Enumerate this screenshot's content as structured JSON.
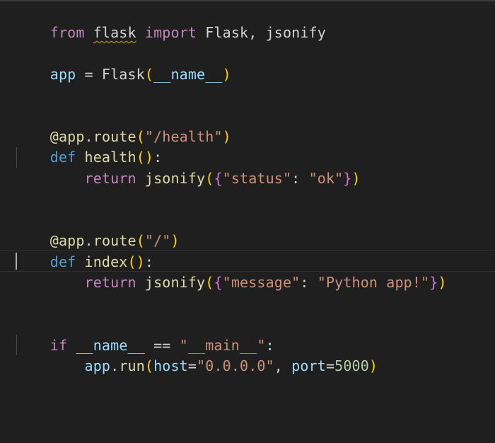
{
  "lines": {
    "l1": {
      "t1": "from",
      "t2": " ",
      "t3": "flask",
      "t4": " ",
      "t5": "import",
      "t6": " Flask, jsonify"
    },
    "l3": {
      "t1": "app",
      "t2": " = ",
      "t3": "Flask",
      "t4": "(",
      "t5": "__name__",
      "t6": ")"
    },
    "l6": {
      "t1": "@",
      "t2": "app",
      "t3": ".",
      "t4": "route",
      "t5": "(",
      "t6": "\"/health\"",
      "t7": ")"
    },
    "l7": {
      "t1": "def",
      "t2": " ",
      "t3": "health",
      "t4": "()",
      "t5": ":"
    },
    "l8": {
      "t1": "    ",
      "t2": "return",
      "t3": " ",
      "t4": "jsonify",
      "t5": "(",
      "t6": "{",
      "t7": "\"status\"",
      "t8": ": ",
      "t9": "\"ok\"",
      "t10": "}",
      "t11": ")"
    },
    "l11": {
      "t1": "@",
      "t2": "app",
      "t3": ".",
      "t4": "route",
      "t5": "(",
      "t6": "\"/\"",
      "t7": ")"
    },
    "l12": {
      "t1": "def",
      "t2": " ",
      "t3": "index",
      "t4": "()",
      "t5": ":"
    },
    "l13": {
      "t1": "    ",
      "t2": "return",
      "t3": " ",
      "t4": "jsonify",
      "t5": "(",
      "t6": "{",
      "t7": "\"message\"",
      "t8": ": ",
      "t9": "\"Python app!\"",
      "t10": "}",
      "t11": ")"
    },
    "l16": {
      "t1": "if",
      "t2": " ",
      "t3": "__name__",
      "t4": " == ",
      "t5": "\"__main__\"",
      "t6": ":"
    },
    "l17": {
      "t1": "    ",
      "t2": "app",
      "t3": ".",
      "t4": "run",
      "t5": "(",
      "t6": "host",
      "t7": "=",
      "t8": "\"0.0.0.0\"",
      "t9": ", ",
      "t10": "port",
      "t11": "=",
      "t12": "5000",
      "t13": ")"
    }
  },
  "colors": {
    "background": "#1f1f1f",
    "keyword_control": "#c586c0",
    "keyword_def": "#569cd6",
    "variable": "#9cdcfe",
    "function": "#dcdcaa",
    "string": "#ce9178",
    "number": "#b5cea8",
    "bracket_level1": "#ffd700",
    "bracket_level2": "#da70d6",
    "warning_squiggle": "#cca700"
  }
}
